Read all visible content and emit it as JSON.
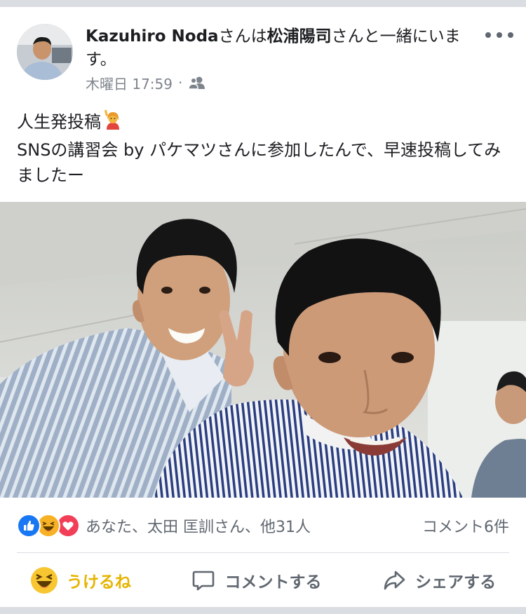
{
  "post": {
    "author": "Kazuhiro Noda",
    "connector_1": "さんは",
    "tagged": "松浦陽司",
    "connector_2": "さんと一緒にいます。",
    "timestamp": "木曜日 17:59",
    "dot": "·",
    "text_line_1": "人生発投稿",
    "text_line_2": "SNSの講習会  by  パケマツさんに参加したんで、早速投稿してみましたー"
  },
  "reactions": {
    "names": "あなた、太田 匡訓さん、他31人",
    "comments": "コメント6件"
  },
  "actions": {
    "haha_label": "うけるね",
    "comment_label": "コメントする",
    "share_label": "シェアする"
  },
  "icons": {
    "more": "more-horizontal-icon",
    "audience": "friends-icon",
    "emoji": "woman-raising-hand-emoji",
    "like": "like-reaction-icon",
    "haha": "haha-reaction-icon",
    "love": "love-reaction-icon",
    "comment": "comment-icon",
    "share": "share-icon"
  },
  "colors": {
    "like": "#1877f2",
    "haha": "#f7b125",
    "love": "#f33e58",
    "haha_active_text": "#e6b400",
    "meta_text": "#7e848c",
    "secondary_text": "#606770"
  }
}
